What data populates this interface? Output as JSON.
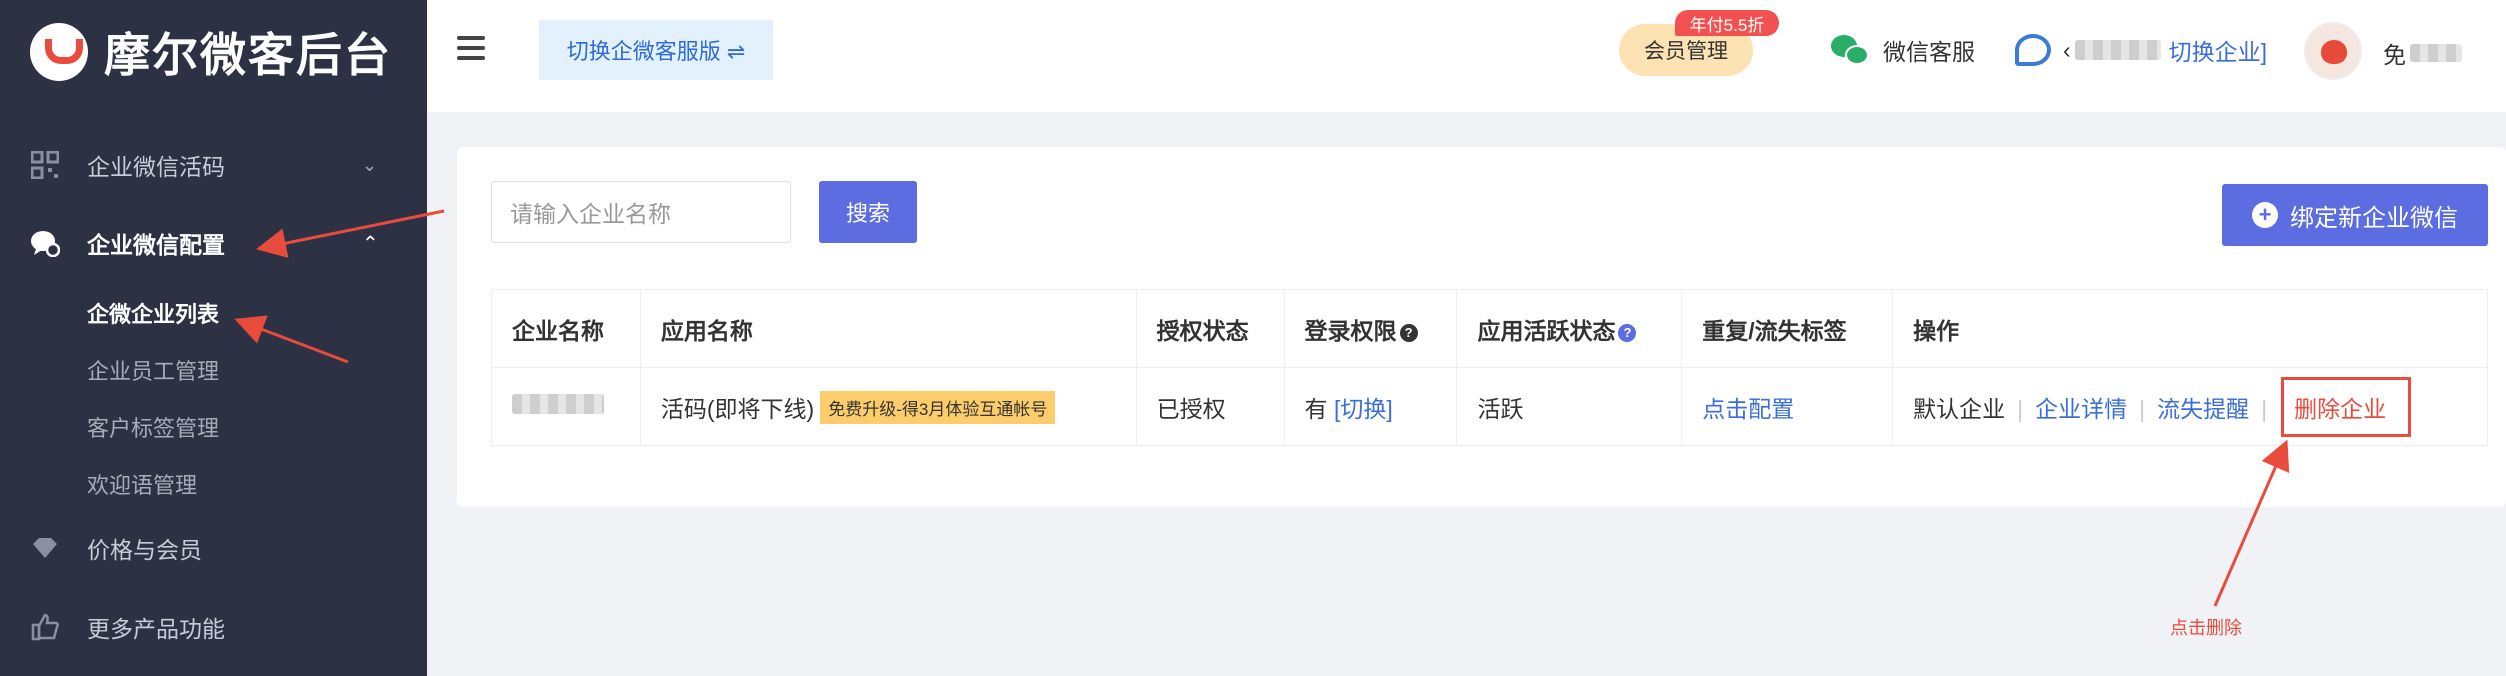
{
  "sidebar": {
    "brand": "摩尔微客后台",
    "menu": [
      {
        "label": "企业微信活码",
        "icon": "qrcode-icon",
        "expanded": false
      },
      {
        "label": "企业微信配置",
        "icon": "chat-settings-icon",
        "expanded": true
      },
      {
        "label": "价格与会员",
        "icon": "diamond-icon"
      },
      {
        "label": "更多产品功能",
        "icon": "thumbs-up-icon"
      }
    ],
    "submenu": [
      "企微企业列表",
      "企业员工管理",
      "客户标签管理",
      "欢迎语管理"
    ]
  },
  "header": {
    "switch_label": "切换企微客服版 ⇌",
    "vip_label": "会员管理",
    "vip_tag": "年付5.5折",
    "wx_service": "微信客服",
    "switch_corp_prefix": "‹",
    "switch_corp_link": "切换企业]",
    "username_prefix": "免"
  },
  "toolbar": {
    "search_placeholder": "请输入企业名称",
    "search_button": "搜索",
    "bind_button": "绑定新企业微信"
  },
  "table": {
    "columns": [
      "企业名称",
      "应用名称",
      "授权状态",
      "登录权限",
      "应用活跃状态",
      "重复/流失标签",
      "操作"
    ],
    "row": {
      "app_name": "活码(即将下线)",
      "promo": "免费升级-得3月体验互通帐号",
      "auth_status": "已授权",
      "login_has": "有",
      "login_switch": "[切换]",
      "active_status": "活跃",
      "config_link": "点击配置",
      "actions": [
        "默认企业",
        "企业详情",
        "流失提醒",
        "删除企业"
      ]
    }
  },
  "annotation": {
    "text": "点击删除"
  },
  "colors": {
    "sidebar": "#2c3244",
    "primary": "#5b6de0",
    "danger": "#e94b3c",
    "success": "#2aae67"
  }
}
